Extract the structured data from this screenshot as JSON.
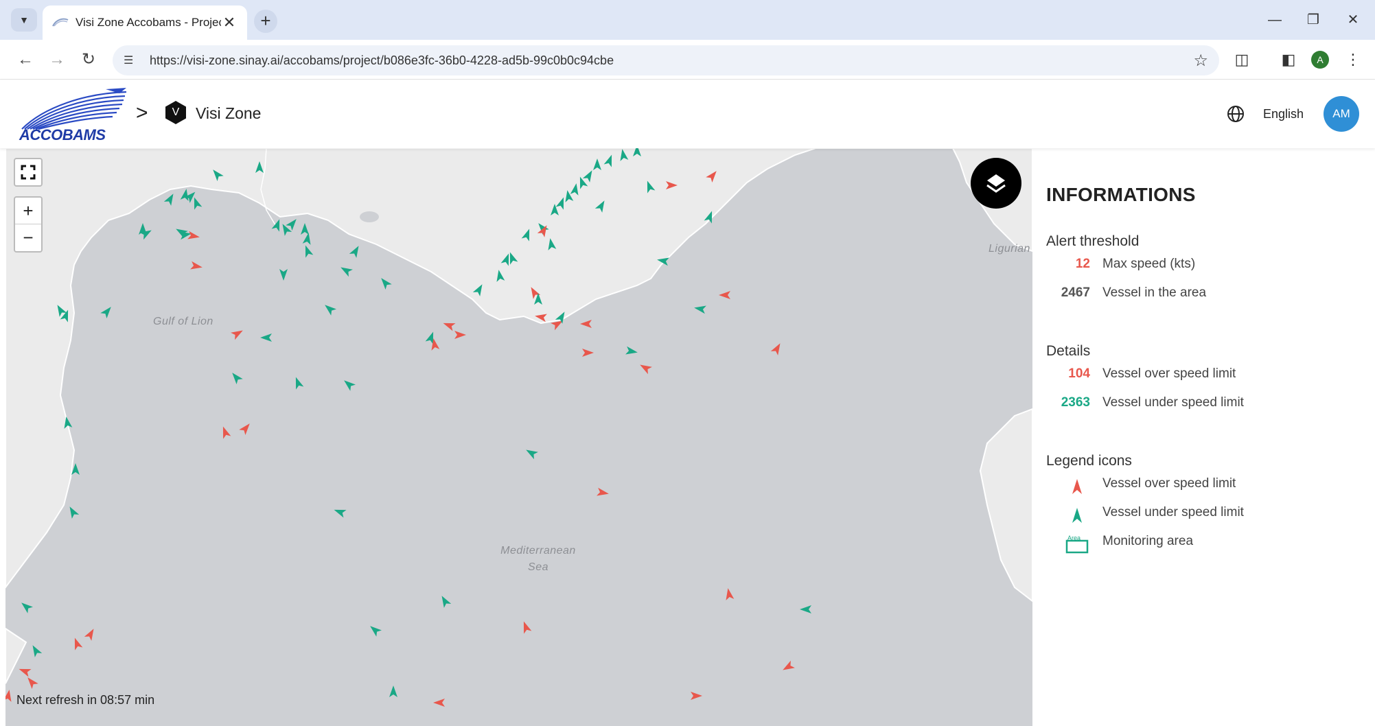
{
  "browser": {
    "tab_title": "Visi Zone Accobams - Project",
    "tab_close": "✕",
    "new_tab": "+",
    "url": "https://visi-zone.sinay.ai/accobams/project/b086e3fc-36b0-4228-ad5b-99c0b0c94cbe",
    "profile_initial": "A",
    "window_controls": {
      "minimize": "—",
      "restore": "❐",
      "close": "✕"
    }
  },
  "header": {
    "logo_text": "ACCOBAMS",
    "breadcrumb_separator": ">",
    "project_initial": "V",
    "project_name": "Visi Zone",
    "language": "English",
    "user_initials": "AM"
  },
  "map": {
    "labels": {
      "gulf": "Gulf of Lion",
      "sea_line1": "Mediterranean",
      "sea_line2": "Sea",
      "ligurian": "Ligurian"
    },
    "zoom_in": "+",
    "zoom_out": "−",
    "refresh_text": "Next refresh in 08:57 min"
  },
  "panel": {
    "title": "INFORMATIONS",
    "alert_threshold": {
      "heading": "Alert threshold",
      "max_speed_value": "12",
      "max_speed_label": "Max speed (kts)",
      "vessels_value": "2467",
      "vessels_label": "Vessel in the area"
    },
    "details": {
      "heading": "Details",
      "over_value": "104",
      "over_label": "Vessel over speed limit",
      "under_value": "2363",
      "under_label": "Vessel under speed limit"
    },
    "legend": {
      "heading": "Legend icons",
      "over_label": "Vessel over speed limit",
      "under_label": "Vessel under speed limit",
      "area_label": "Monitoring area",
      "area_icon_text": "Area"
    }
  },
  "colors": {
    "over_speed": "#e8574c",
    "under_speed": "#1aa886",
    "accent": "#2f8fd6"
  }
}
